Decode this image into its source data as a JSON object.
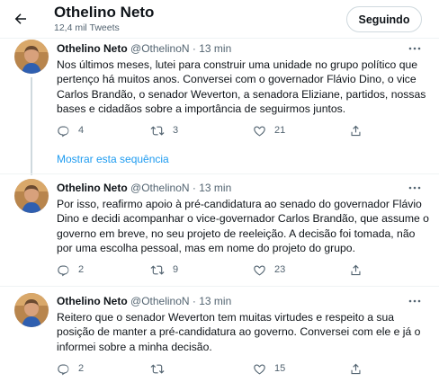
{
  "header": {
    "title": "Othelino Neto",
    "subtitle": "12,4 mil Tweets",
    "follow_label": "Seguindo"
  },
  "colors": {
    "accent": "#1d9bf0",
    "text": "#0f1419",
    "muted": "#536471",
    "thread_line": "#cfd9de"
  },
  "icons": {
    "back": "arrow-left-icon",
    "more": "more-horizontal-icon",
    "reply": "reply-icon",
    "retweet": "retweet-icon",
    "like": "heart-icon",
    "share": "share-icon"
  },
  "show_thread_label": "Mostrar esta sequência",
  "tweets": [
    {
      "name": "Othelino Neto",
      "handle": "@OthelinoN",
      "separator": "·",
      "time": "13 min",
      "text": "Nos últimos meses, lutei para construir uma unidade no grupo político que pertenço há muitos anos. Conversei com o governador Flávio Dino, o vice Carlos Brandão, o senador Weverton, a senadora Eliziane, partidos, nossas bases e cidadãos sobre a importância de seguirmos juntos.",
      "replies": "4",
      "retweets": "3",
      "likes": "21"
    },
    {
      "name": "Othelino Neto",
      "handle": "@OthelinoN",
      "separator": "·",
      "time": "13 min",
      "text": "Por isso, reafirmo apoio à pré-candidatura ao senado do governador Flávio Dino e decidi acompanhar o vice-governador Carlos Brandão, que assume o governo em breve, no seu projeto de reeleição. A decisão foi tomada, não por uma escolha pessoal, mas em nome do projeto do grupo.",
      "replies": "2",
      "retweets": "9",
      "likes": "23"
    },
    {
      "name": "Othelino Neto",
      "handle": "@OthelinoN",
      "separator": "·",
      "time": "13 min",
      "text": "Reitero que o senador Weverton tem muitas virtudes e respeito a sua posição de manter a pré-candidatura ao governo. Conversei com ele e já o informei sobre a minha decisão.",
      "replies": "2",
      "retweets": "",
      "likes": "15"
    }
  ]
}
